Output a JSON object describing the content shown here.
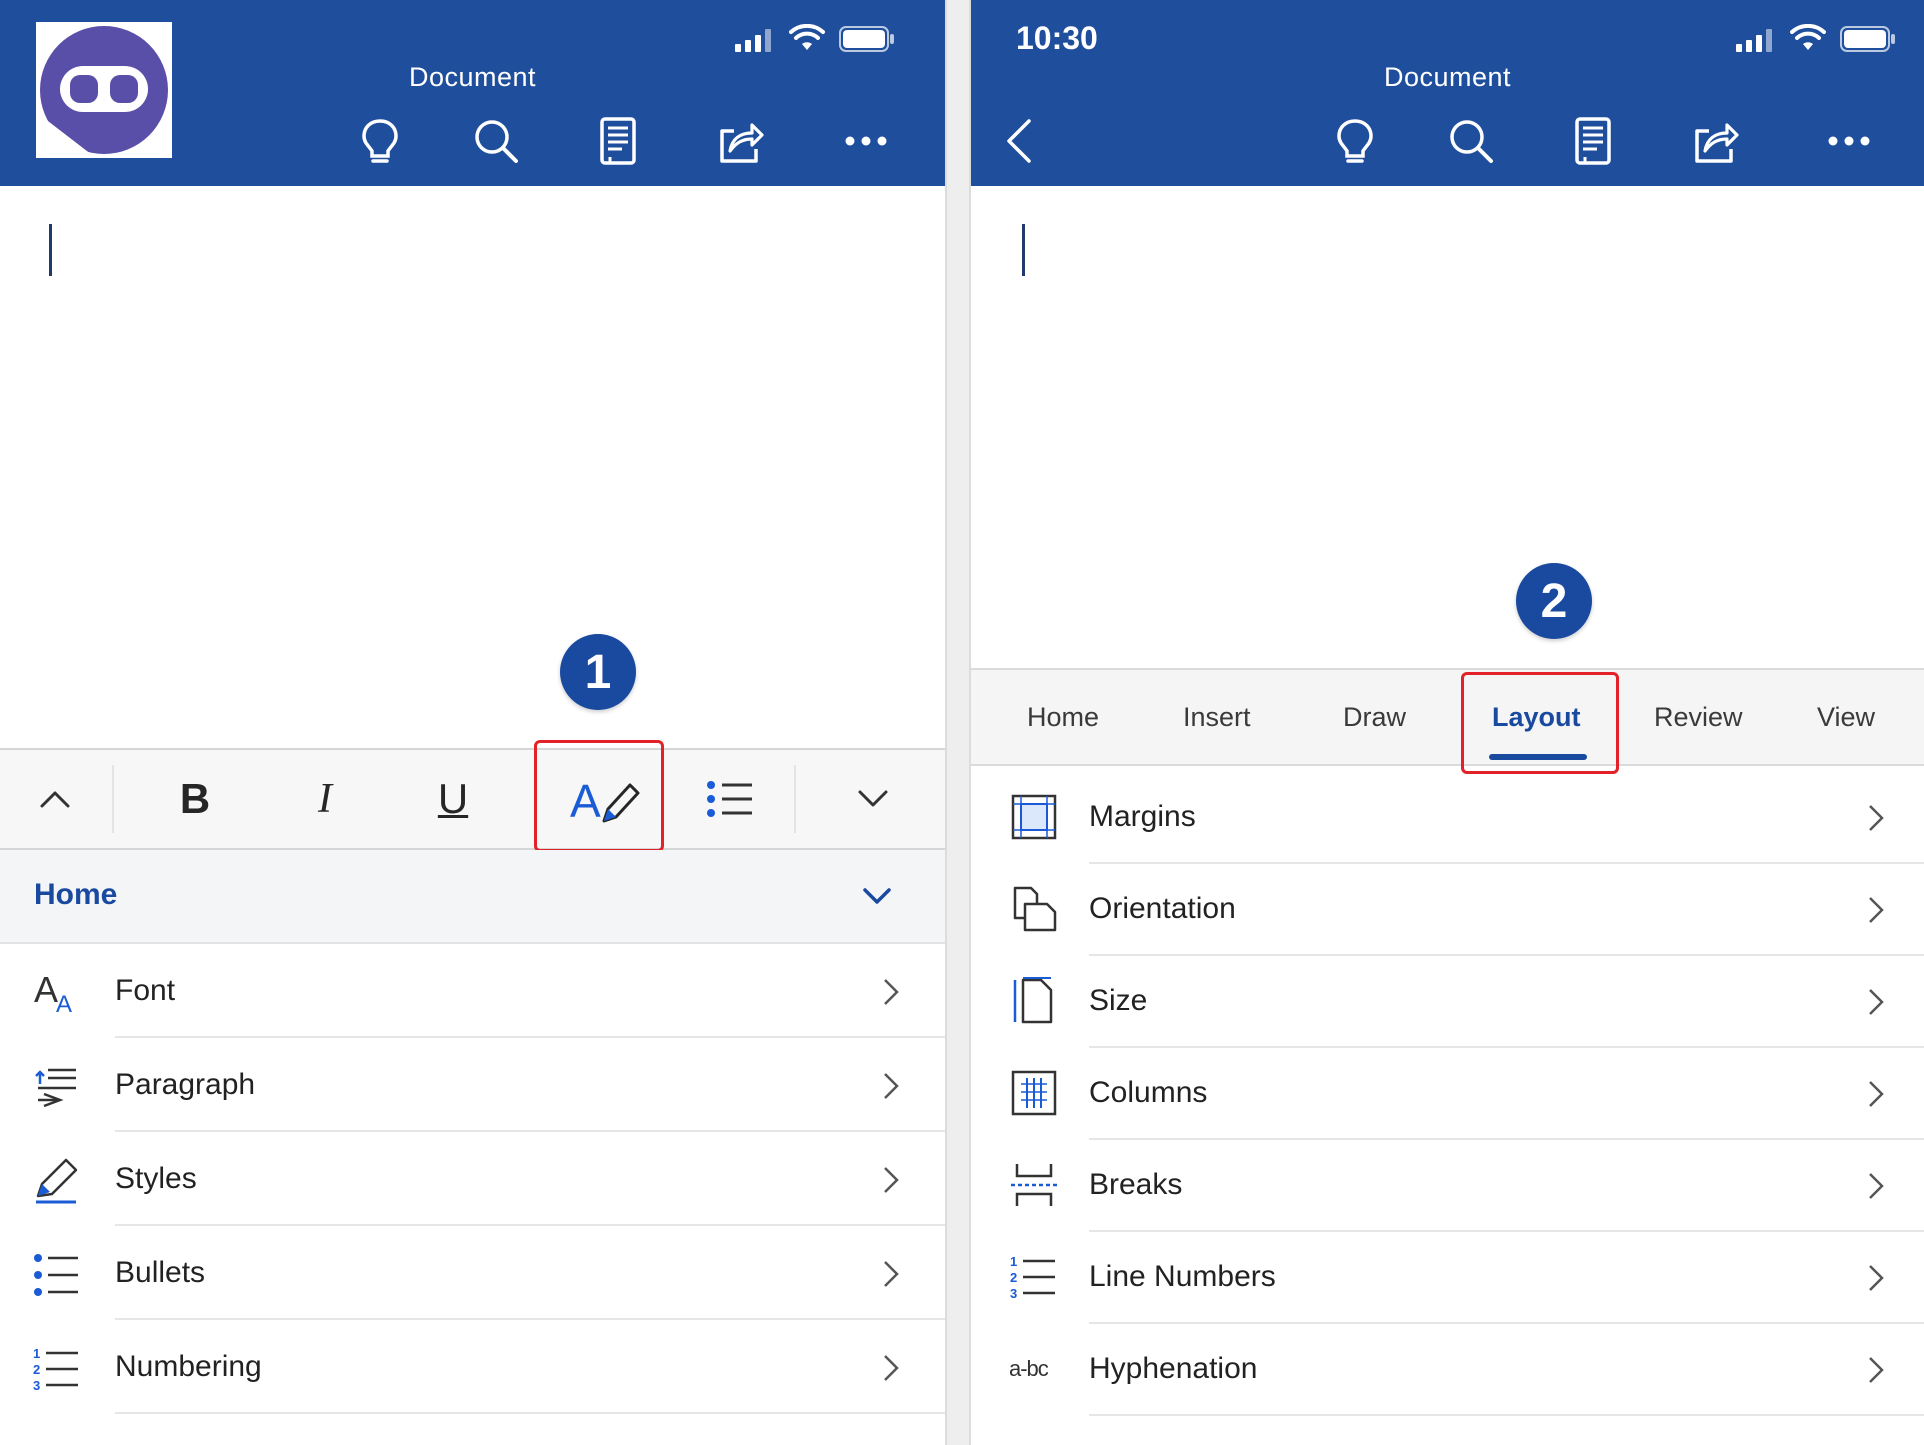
{
  "colors": {
    "brand_blue": "#1e4e9c",
    "accent_blue": "#1a4aa0",
    "highlight_red": "#e22128"
  },
  "left": {
    "title": "Document",
    "toolbar_icons": [
      "lightbulb-icon",
      "search-icon",
      "reader-icon",
      "share-icon",
      "more-icon"
    ],
    "badge": "1",
    "format_bar": {
      "bold": "B",
      "italic": "I",
      "underline": "U"
    },
    "section_title": "Home",
    "menu": [
      "Font",
      "Paragraph",
      "Styles",
      "Bullets",
      "Numbering"
    ]
  },
  "right": {
    "time": "10:30",
    "title": "Document",
    "badge": "2",
    "tabs": [
      "Home",
      "Insert",
      "Draw",
      "Layout",
      "Review",
      "View"
    ],
    "active_tab": "Layout",
    "menu": [
      "Margins",
      "Orientation",
      "Size",
      "Columns",
      "Breaks",
      "Line Numbers",
      "Hyphenation"
    ]
  }
}
